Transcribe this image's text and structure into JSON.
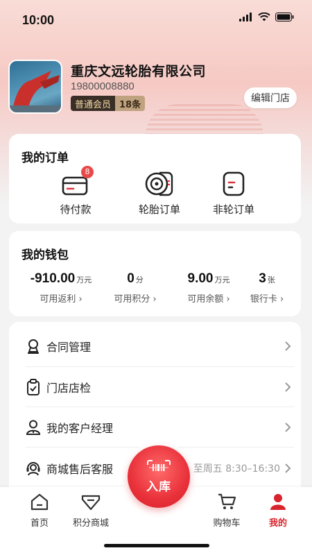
{
  "status_bar": {
    "time": "10:00"
  },
  "profile": {
    "store_name": "重庆文远轮胎有限公司",
    "phone": "19800008880",
    "member_level": "普通会员",
    "member_count": "18条",
    "edit_button": "编辑门店"
  },
  "orders": {
    "title": "我的订单",
    "items": [
      {
        "label": "待付款",
        "icon": "wallet-card-icon",
        "badge": "8"
      },
      {
        "label": "轮胎订单",
        "icon": "tire-icon"
      },
      {
        "label": "非轮订单",
        "icon": "document-icon"
      }
    ]
  },
  "wallet": {
    "title": "我的钱包",
    "items": [
      {
        "value": "-910.00",
        "unit": "万元",
        "label": "可用返利 ›"
      },
      {
        "value": "0",
        "unit": "分",
        "label": "可用积分 ›"
      },
      {
        "value": "9.00",
        "unit": "万元",
        "label": "可用余额 ›"
      },
      {
        "value": "3",
        "unit": "张",
        "label": "银行卡 ›"
      }
    ]
  },
  "menu": {
    "items": [
      {
        "label": "合同管理",
        "icon": "contract-icon"
      },
      {
        "label": "门店店检",
        "icon": "clipboard-check-icon"
      },
      {
        "label": "我的客户经理",
        "icon": "manager-icon"
      },
      {
        "label": "商城售后客服",
        "icon": "customer-service-icon",
        "hint": "-至周五 8:30–16:30"
      }
    ]
  },
  "bottom_nav": {
    "items": [
      {
        "label": "首页",
        "icon": "home-icon"
      },
      {
        "label": "积分商城",
        "icon": "points-mall-icon"
      },
      {
        "label": "购物车",
        "icon": "cart-icon"
      },
      {
        "label": "我的",
        "icon": "profile-icon",
        "active": true
      }
    ],
    "center_button": "入库"
  },
  "colors": {
    "accent": "#d8242c",
    "badge": "#e84a4a"
  }
}
